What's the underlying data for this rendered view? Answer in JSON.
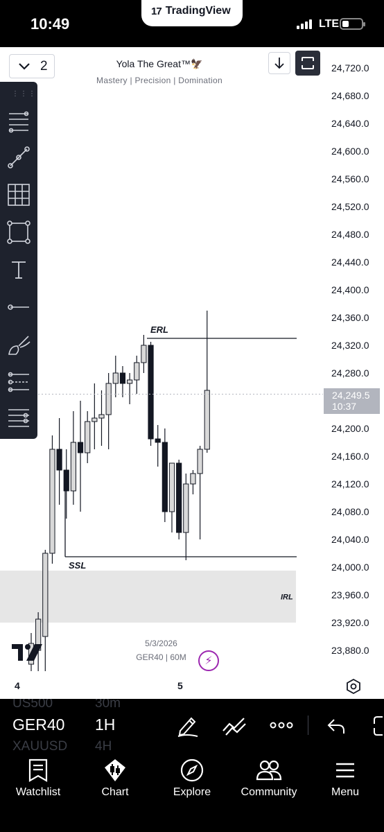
{
  "status_bar": {
    "time": "10:49",
    "app": "TradingView",
    "network": "LTE"
  },
  "chart": {
    "interval_count": "2",
    "watermark_title": "Yola The Great™🦅",
    "watermark_subtitle": "Mastery |  Precision  |  Domination",
    "price_labels": [
      "24,720.0",
      "24,680.0",
      "24,640.0",
      "24,600.0",
      "24,560.0",
      "24,520.0",
      "24,480.0",
      "24,440.0",
      "24,400.0",
      "24,360.0",
      "24,320.0",
      "24,280.0",
      "24,200.0",
      "24,160.0",
      "24,120.0",
      "24,080.0",
      "24,040.0",
      "24,000.0",
      "23,960.0",
      "23,920.0",
      "23,880.0"
    ],
    "current_price": "24,249.5",
    "countdown": "10:37",
    "annotations": {
      "erl": "ERL",
      "ssl": "SSL",
      "irl": "IRL"
    },
    "date_label": "5/3/2026",
    "symbol_info": "GER40 | 60M",
    "time_ticks": [
      "4",
      "5"
    ]
  },
  "chart_data": {
    "type": "candlestick",
    "symbol": "GER40",
    "interval": "60M",
    "ylim": [
      23860,
      24740
    ],
    "levels": {
      "ERL": 24330,
      "SSL": 24015,
      "IRL_zone": [
        23920,
        23995
      ]
    },
    "last_price": 24249.5,
    "candles": [
      {
        "o": 23860,
        "h": 23905,
        "l": 23850,
        "c": 23890
      },
      {
        "o": 23880,
        "h": 23935,
        "l": 23850,
        "c": 23925
      },
      {
        "o": 23900,
        "h": 24025,
        "l": 23850,
        "c": 24020
      },
      {
        "o": 24020,
        "h": 24190,
        "l": 24005,
        "c": 24170
      },
      {
        "o": 24170,
        "h": 24215,
        "l": 24090,
        "c": 24140
      },
      {
        "o": 24140,
        "h": 24170,
        "l": 24070,
        "c": 24110
      },
      {
        "o": 24110,
        "h": 24225,
        "l": 24090,
        "c": 24180
      },
      {
        "o": 24180,
        "h": 24240,
        "l": 24080,
        "c": 24165
      },
      {
        "o": 24165,
        "h": 24225,
        "l": 24150,
        "c": 24210
      },
      {
        "o": 24210,
        "h": 24265,
        "l": 24170,
        "c": 24215
      },
      {
        "o": 24215,
        "h": 24255,
        "l": 24175,
        "c": 24220
      },
      {
        "o": 24220,
        "h": 24280,
        "l": 24170,
        "c": 24265
      },
      {
        "o": 24265,
        "h": 24305,
        "l": 24245,
        "c": 24280
      },
      {
        "o": 24280,
        "h": 24290,
        "l": 24245,
        "c": 24265
      },
      {
        "o": 24265,
        "h": 24280,
        "l": 24235,
        "c": 24270
      },
      {
        "o": 24270,
        "h": 24305,
        "l": 24250,
        "c": 24295
      },
      {
        "o": 24295,
        "h": 24335,
        "l": 24280,
        "c": 24320
      },
      {
        "o": 24320,
        "h": 24325,
        "l": 24175,
        "c": 24185
      },
      {
        "o": 24185,
        "h": 24205,
        "l": 24145,
        "c": 24180
      },
      {
        "o": 24180,
        "h": 24200,
        "l": 24065,
        "c": 24080
      },
      {
        "o": 24080,
        "h": 24135,
        "l": 24050,
        "c": 24150
      },
      {
        "o": 24150,
        "h": 24155,
        "l": 24040,
        "c": 24050
      },
      {
        "o": 24050,
        "h": 24135,
        "l": 24010,
        "c": 24120
      },
      {
        "o": 24120,
        "h": 24140,
        "l": 24105,
        "c": 24135
      },
      {
        "o": 24135,
        "h": 24175,
        "l": 24040,
        "c": 24170
      },
      {
        "o": 24170,
        "h": 24370,
        "l": 24165,
        "c": 24255
      }
    ]
  },
  "symbol_bar": {
    "symbol": "GER40",
    "timeframe": "1H",
    "ghost_prev_symbol": "US500",
    "ghost_prev_tf": "30m",
    "ghost_next_symbol": "XAUUSD",
    "ghost_next_tf": "4H"
  },
  "nav": {
    "watchlist": "Watchlist",
    "chart": "Chart",
    "explore": "Explore",
    "community": "Community",
    "menu": "Menu"
  }
}
